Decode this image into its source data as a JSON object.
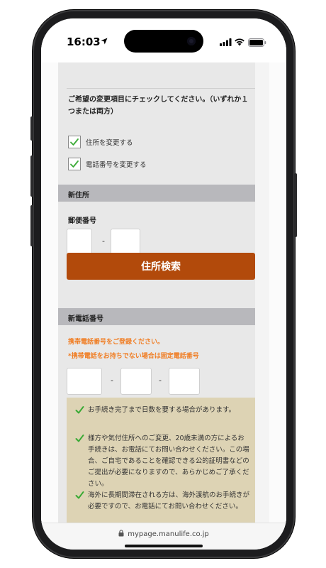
{
  "status_bar": {
    "time": "16:03",
    "icons": [
      "location-arrow-icon",
      "signal-icon",
      "wifi-icon",
      "battery-icon"
    ]
  },
  "form": {
    "instruction": "ご希望の変更項目にチェックしてください。（いずれか１つまたは両方）",
    "options": [
      {
        "label": "住所を変更する",
        "checked": true
      },
      {
        "label": "電話番号を変更する",
        "checked": true
      }
    ],
    "new_address": {
      "section_title": "新住所",
      "postal_label": "郵便番号",
      "postal_separator": "-",
      "postal_part1": "",
      "postal_part2": "",
      "search_button": "住所検索"
    },
    "new_phone": {
      "section_title": "新電話番号",
      "note1": "携帯電話番号をご登録ください。",
      "note2": "*携帯電話をお持ちでない場合は固定電話番号",
      "separator": "-",
      "part1": "",
      "part2": "",
      "part3": ""
    },
    "notes": [
      "お手続き完了まで日数を要する場合があります。",
      "様方や気付住所へのご変更、20歳未満の方によるお手続きは、お電話にてお問い合わせください。この場合、ご自宅であることを確認できる公的証明書などのご提出が必要になりますので、あらかじめご了承ください。",
      "海外に長期間滞在される方は、海外渡航のお手続きが必要ですので、お電話にてお問い合わせください。"
    ]
  },
  "browser": {
    "url": "mypage.manulife.co.jp"
  },
  "colors": {
    "accent_button": "#b24a0b",
    "orange_text": "#f07d23",
    "check_green": "#3aaa35",
    "notes_background": "#ddd3b4",
    "section_bar": "#b8b8bc"
  }
}
